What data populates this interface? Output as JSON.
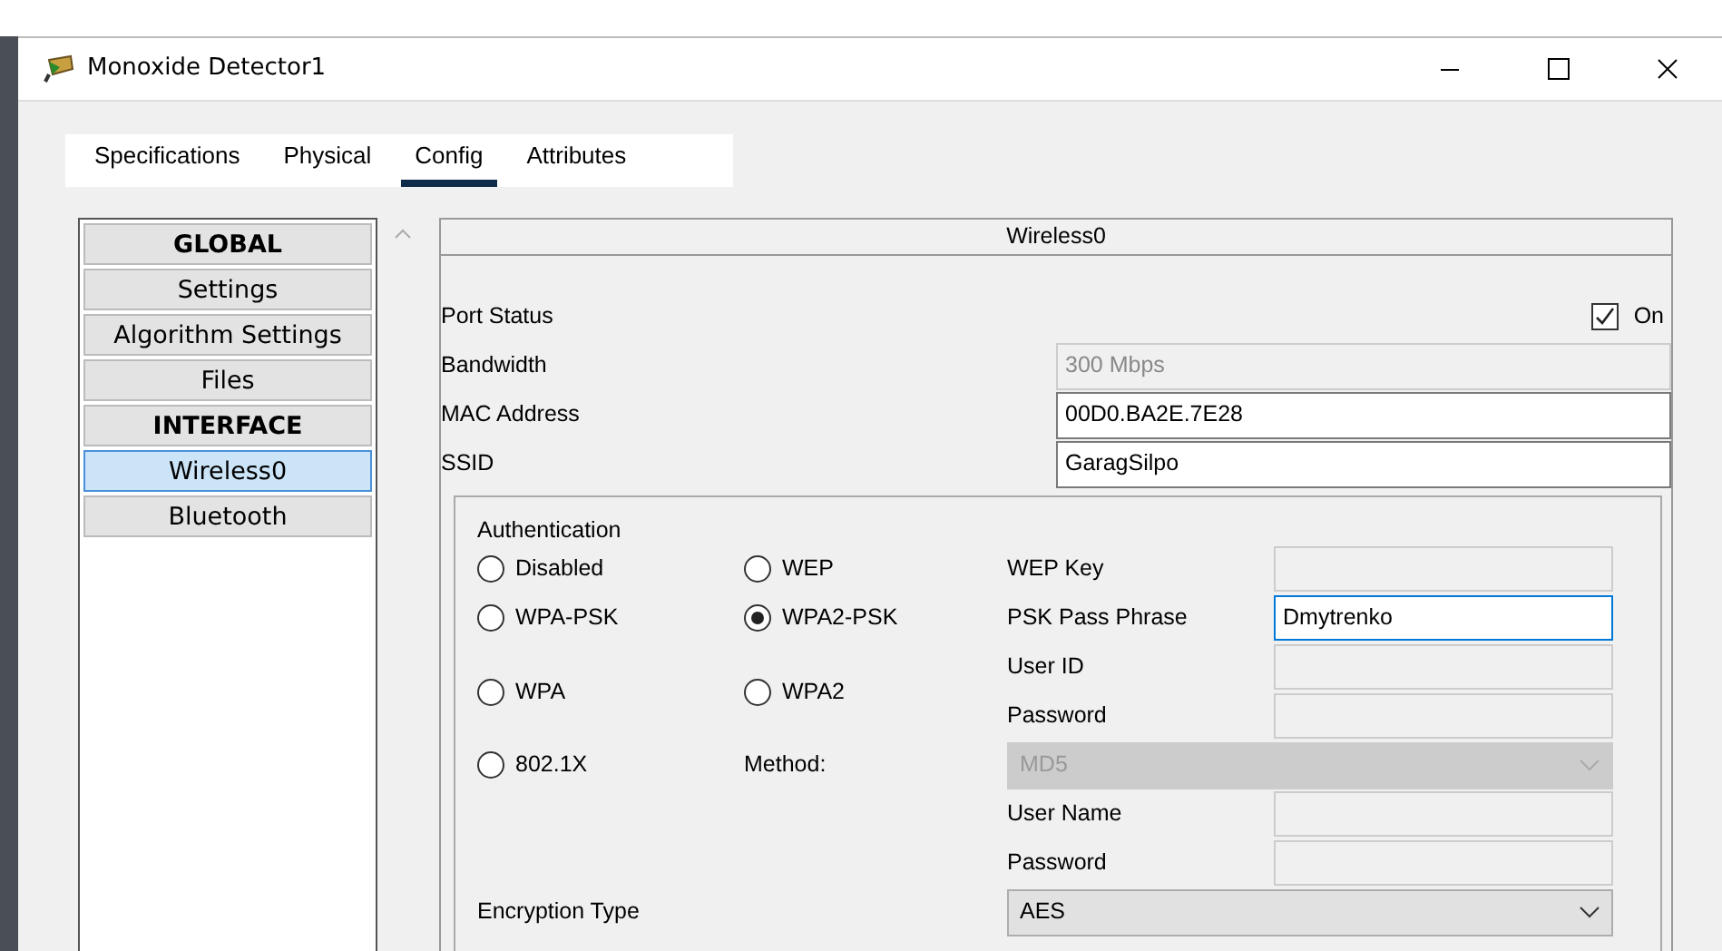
{
  "window": {
    "title": "Monoxide Detector1"
  },
  "tabs": [
    {
      "label": "Specifications",
      "selected": false
    },
    {
      "label": "Physical",
      "selected": false
    },
    {
      "label": "Config",
      "selected": true
    },
    {
      "label": "Attributes",
      "selected": false
    }
  ],
  "sidebar": {
    "items": [
      {
        "label": "GLOBAL",
        "kind": "header",
        "selected": false
      },
      {
        "label": "Settings",
        "kind": "item",
        "selected": false
      },
      {
        "label": "Algorithm Settings",
        "kind": "item",
        "selected": false
      },
      {
        "label": "Files",
        "kind": "item",
        "selected": false
      },
      {
        "label": "INTERFACE",
        "kind": "header",
        "selected": false
      },
      {
        "label": "Wireless0",
        "kind": "item",
        "selected": true
      },
      {
        "label": "Bluetooth",
        "kind": "item",
        "selected": false
      }
    ]
  },
  "panel": {
    "title": "Wireless0",
    "port_status": {
      "label": "Port Status",
      "checked": true,
      "option": "On"
    },
    "fields": [
      {
        "label": "Bandwidth",
        "value": "300 Mbps",
        "disabled": true
      },
      {
        "label": "MAC Address",
        "value": "00D0.BA2E.7E28",
        "disabled": false
      },
      {
        "label": "SSID",
        "value": "GaragSilpo",
        "disabled": false
      }
    ],
    "authentication": {
      "title": "Authentication",
      "options": [
        {
          "label": "Disabled",
          "selected": false
        },
        {
          "label": "WEP",
          "selected": false
        },
        {
          "label": "WPA-PSK",
          "selected": false
        },
        {
          "label": "WPA2-PSK",
          "selected": true
        },
        {
          "label": "WPA",
          "selected": false
        },
        {
          "label": "WPA2",
          "selected": false
        },
        {
          "label": "802.1X",
          "selected": false
        }
      ],
      "fields": [
        {
          "label": "WEP Key",
          "disabled": true,
          "focused": false
        },
        {
          "label": "PSK Pass Phrase",
          "value": "Dmytrenko",
          "disabled": false,
          "focused": true
        },
        {
          "label": "User ID",
          "disabled": true,
          "focused": false
        },
        {
          "label": "Password",
          "disabled": true,
          "focused": false
        },
        {
          "label": "User Name",
          "disabled": true,
          "focused": false
        },
        {
          "label": "Password",
          "disabled": true,
          "focused": false
        }
      ],
      "method": {
        "label": "Method:",
        "value": "MD5",
        "disabled": true
      },
      "encryption": {
        "label": "Encryption Type",
        "value": "AES",
        "disabled": false
      }
    }
  }
}
